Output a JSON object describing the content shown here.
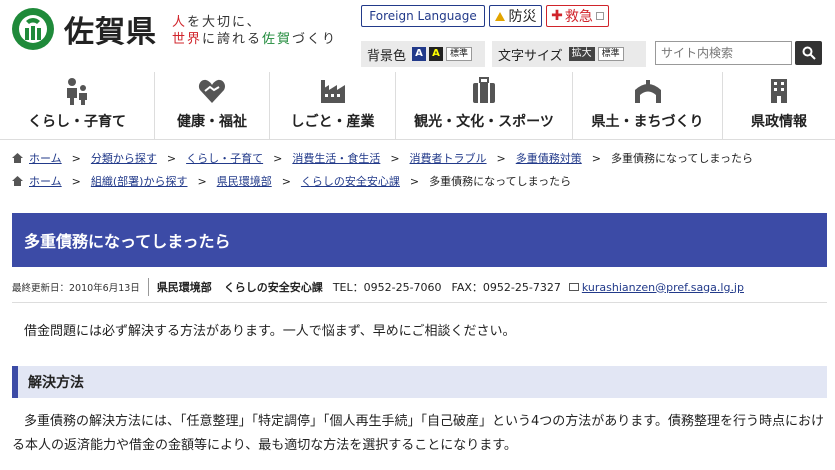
{
  "header": {
    "logo_text": "佐賀県",
    "tagline_line1": [
      "人",
      "を大切に、"
    ],
    "tagline_line2": [
      "世界",
      "に誇れる",
      "佐賀",
      "づくり"
    ],
    "foreign_language": "Foreign Language",
    "bousai": "防災",
    "kyukyu": "救急",
    "bg_color_label": "背景色",
    "bg_swatch_blue": "A",
    "bg_swatch_yellow": "A",
    "bg_standard": "標準",
    "font_size_label": "文字サイズ",
    "font_big": "拡大",
    "font_standard": "標準",
    "search_placeholder": "サイト内検索"
  },
  "gnav": [
    {
      "label": "くらし・子育て",
      "icon": "family-icon"
    },
    {
      "label": "健康・福祉",
      "icon": "heart-hands-icon"
    },
    {
      "label": "しごと・産業",
      "icon": "factory-icon"
    },
    {
      "label": "観光・文化・スポーツ",
      "icon": "suitcase-icon"
    },
    {
      "label": "県土・まちづくり",
      "icon": "bridge-icon"
    },
    {
      "label": "県政情報",
      "icon": "building-icon"
    }
  ],
  "breadcrumbs": [
    {
      "links": [
        "ホーム",
        "分類から探す",
        "くらし・子育て",
        "消費生活・食生活",
        "消費者トラブル",
        "多重債務対策"
      ],
      "current": "多重債務になってしまったら"
    },
    {
      "links": [
        "ホーム",
        "組織(部署)から探す",
        "県民環境部",
        "くらしの安全安心課"
      ],
      "current": "多重債務になってしまったら"
    }
  ],
  "page": {
    "title": "多重債務になってしまったら",
    "updated": "最終更新日：2010年6月13日",
    "department": "県民環境部",
    "section": "くらしの安全安心課",
    "tel": "TEL：0952-25-7060",
    "fax": "FAX：0952-25-7327",
    "email": "kurashianzen@pref.saga.lg.jp",
    "intro": "借金問題には必ず解決する方法があります。一人で悩まず、早めにご相談ください。",
    "section_heading": "解決方法",
    "body": "多重債務の解決方法には、「任意整理」「特定調停」「個人再生手続」「自己破産」という4つの方法があります。債務整理を行う時点における本人の返済能力や借金の金額等により、最も適切な方法を選択することになります。"
  },
  "colors": {
    "brand_navy": "#223a8a",
    "title_bar": "#3c4ba6",
    "heading_bg": "#e2e6f4",
    "logo_green": "#1f8a3a",
    "accent_red": "#d0242b"
  }
}
